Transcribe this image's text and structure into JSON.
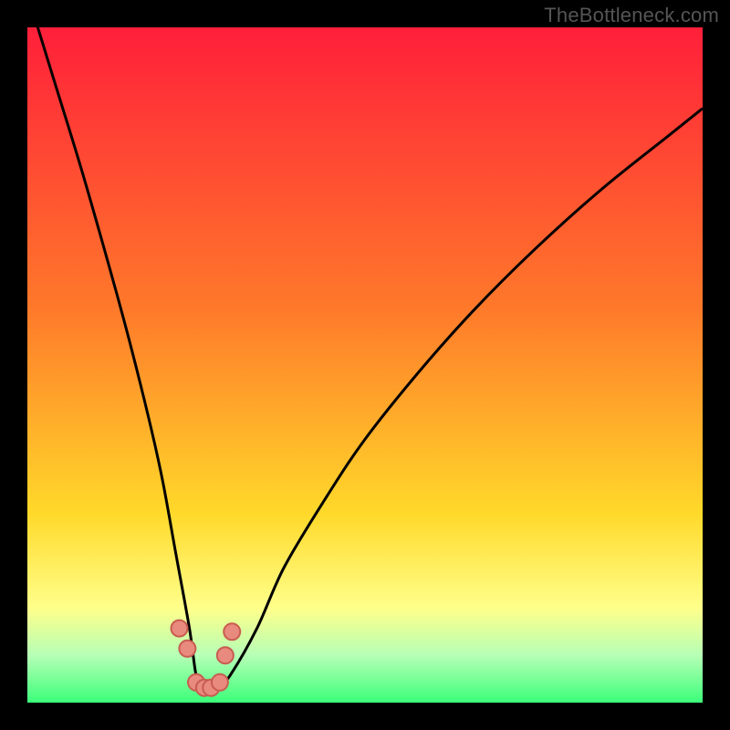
{
  "watermark": "TheBottleneck.com",
  "colors": {
    "top": "#ff1f3a",
    "mid1": "#ff7a2a",
    "mid2": "#ffd92a",
    "yellow_band": "#ffff8a",
    "green_band_light": "#b6ffb6",
    "green_band": "#3bff79",
    "curve": "#000000",
    "marker_fill": "#e88a7e",
    "marker_stroke": "#c85c50",
    "frame": "#000000"
  },
  "chart_data": {
    "type": "line",
    "title": "",
    "xlabel": "",
    "ylabel": "",
    "xlim": [
      0,
      100
    ],
    "ylim": [
      0,
      100
    ],
    "series": [
      {
        "name": "bottleneck-curve",
        "x": [
          0,
          4,
          8,
          12,
          15,
          18,
          20,
          22,
          24,
          25,
          26,
          28,
          30,
          34,
          38,
          44,
          50,
          58,
          66,
          75,
          85,
          95,
          100
        ],
        "values": [
          105,
          92,
          79,
          65,
          54,
          42,
          33,
          22,
          11,
          4,
          2,
          2,
          4,
          11,
          20,
          30,
          39,
          49,
          58,
          67,
          76,
          84,
          88
        ]
      }
    ],
    "markers": {
      "name": "highlight-points",
      "x": [
        22.5,
        23.7,
        25.0,
        26.2,
        27.2,
        28.5,
        29.3,
        30.3
      ],
      "values": [
        11.0,
        8.0,
        3.0,
        2.2,
        2.2,
        3.0,
        7.0,
        10.5
      ]
    }
  }
}
